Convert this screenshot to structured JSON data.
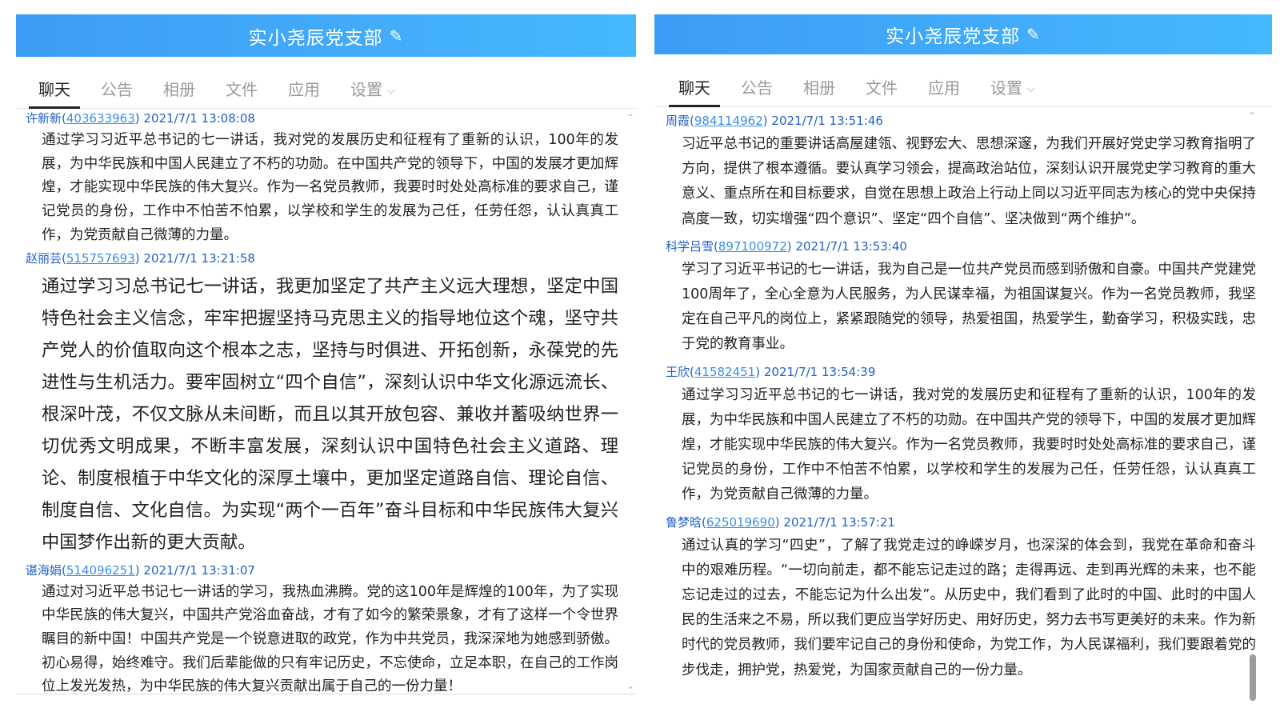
{
  "left": {
    "header_title": "实小尧辰党支部",
    "tabs": [
      {
        "label": "聊天"
      },
      {
        "label": "公告"
      },
      {
        "label": "相册"
      },
      {
        "label": "文件"
      },
      {
        "label": "应用"
      },
      {
        "label": "设置"
      }
    ],
    "messages": [
      {
        "name": "许新新",
        "qq": "403633963",
        "time": "2021/7/1 13:08:08",
        "text": "通过学习习近平总书记的七一讲话，我对党的发展历史和征程有了重新的认识，100年的发展，为中华民族和中国人民建立了不朽的功勋。在中国共产党的领导下，中国的发展才更加辉煌，才能实现中华民族的伟大复兴。作为一名党员教师，我要时时处处高标准的要求自己，谨记党员的身份，工作中不怕苦不怕累，以学校和学生的发展为己任，任劳任怨，认认真真工作，为党贡献自己微薄的力量。"
      },
      {
        "name": "赵丽芸",
        "qq": "515757693",
        "time": "2021/7/1 13:21:58",
        "text": "通过学习习总书记七一讲话，我更加坚定了共产主义远大理想，坚定中国特色社会主义信念，牢牢把握坚持马克思主义的指导地位这个魂，坚守共产党人的价值取向这个根本之志，坚持与时俱进、开拓创新，永葆党的先进性与生机活力。要牢固树立“四个自信”，深刻认识中华文化源远流长、根深叶茂，不仅文脉从未间断，而且以其开放包容、兼收并蓄吸纳世界一切优秀文明成果，不断丰富发展，深刻认识中国特色社会主义道路、理论、制度根植于中华文化的深厚土壤中，更加坚定道路自信、理论自信、制度自信、文化自信。为实现“两个一百年”奋斗目标和中华民族伟大复兴中国梦作出新的更大贡献。"
      },
      {
        "name": "谌海娟",
        "qq": "514096251",
        "time": "2021/7/1 13:31:07",
        "text": "通过对习近平总书记七一讲话的学习，我热血沸腾。党的这100年是辉煌的100年，为了实现中华民族的伟大复兴，中国共产党浴血奋战，才有了如今的繁荣景象，才有了这样一个令世界瞩目的新中国！中国共产党是一个锐意进取的政党，作为中共党员，我深深地为她感到骄傲。初心易得，始终难守。我们后辈能做的只有牢记历史，不忘使命，立足本职，在自己的工作岗位上发光发热，为中华民族的伟大复兴贡献出属于自己的一份力量！"
      }
    ]
  },
  "right": {
    "header_title": "实小尧辰党支部",
    "tabs": [
      {
        "label": "聊天"
      },
      {
        "label": "公告"
      },
      {
        "label": "相册"
      },
      {
        "label": "文件"
      },
      {
        "label": "应用"
      },
      {
        "label": "设置"
      }
    ],
    "messages": [
      {
        "name": "周霞",
        "qq": "984114962",
        "time": "2021/7/1 13:51:46",
        "text": "习近平总书记的重要讲话高屋建瓴、视野宏大、思想深邃，为我们开展好党史学习教育指明了方向，提供了根本遵循。要认真学习领会，提高政治站位，深刻认识开展党史学习教育的重大意义、重点所在和目标要求，自觉在思想上政治上行动上同以习近平同志为核心的党中央保持高度一致，切实增强“四个意识”、坚定“四个自信”、坚决做到“两个维护”。"
      },
      {
        "name": "科学吕雪",
        "qq": "897100972",
        "time": "2021/7/1 13:53:40",
        "text": "学习了习近平书记的七一讲话，我为自己是一位共产党员而感到骄傲和自豪。中国共产党建党100周年了，全心全意为人民服务，为人民谋幸福，为祖国谋复兴。作为一名党员教师，我坚定在自己平凡的岗位上，紧紧跟随党的领导，热爱祖国，热爱学生，勤奋学习，积极实践，忠于党的教育事业。"
      },
      {
        "name": "王欣",
        "qq": "41582451",
        "time": "2021/7/1 13:54:39",
        "text": "通过学习习近平总书记的七一讲话，我对党的发展历史和征程有了重新的认识，100年的发展，为中华民族和中国人民建立了不朽的功勋。在中国共产党的领导下，中国的发展才更加辉煌，才能实现中华民族的伟大复兴。作为一名党员教师，我要时时处处高标准的要求自己，谨记党员的身份，工作中不怕苦不怕累，以学校和学生的发展为己任，任劳任怨，认认真真工作，为党贡献自己微薄的力量。"
      },
      {
        "name": "鲁梦晗",
        "qq": "625019690",
        "time": "2021/7/1 13:57:21",
        "text": "通过认真的学习“四史”，了解了我党走过的峥嵘岁月，也深深的体会到，我党在革命和奋斗中的艰难历程。“一切向前走，都不能忘记走过的路；走得再远、走到再光辉的未来，也不能忘记走过的过去，不能忘记为什么出发”。从历史中，我们看到了此时的中国、此时的中国人民的生活来之不易，所以我们更应当学好历史、用好历史，努力去书写更美好的未来。作为新时代的党员教师，我们要牢记自己的身份和使命，为党工作，为人民谋福利，我们要跟着党的步伐走，拥护党，热爱党，为国家贡献自己的一份力量。"
      }
    ]
  }
}
